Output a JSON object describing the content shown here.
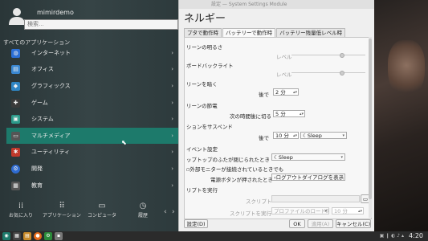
{
  "settings": {
    "title": "設定 — System Settings Module",
    "heading": "ネルギー",
    "tabs": [
      "プタで動作時",
      "バッテリーで動作時",
      "バッテリー残量低レベル時"
    ],
    "rows": {
      "screen_brightness": "リーンの明るさ",
      "level1": "レベル",
      "keyboard_backlight": "ボードバックライト",
      "level2": "レベル",
      "dim_screen": "リーンを暗く",
      "after1": "後で",
      "dim_value": "2 分",
      "screen_off": "リーンの節電",
      "switch_off_after": "次の時間後に切る",
      "screen_off_value": "5 分",
      "suspend": "ションをサスペンド",
      "after2": "後で",
      "suspend_value": "10 分",
      "suspend_mode": "Sleep",
      "event_settings": "イベント設定",
      "laptop_lid": "ップトップのふたが閉じられたとき",
      "lid_action": "Sleep",
      "external_monitor": "外部モニターが接続されているときでも",
      "power_button": "電源ボタンが押されたとき",
      "power_action": "ログアウトダイアログを表示",
      "run_script": "リプトを実行",
      "script_label": "スクリプト",
      "script_run_label": "スクリプトを実行",
      "script_when": "プロファイルのロード時",
      "script_minutes": "10 分"
    },
    "buttons": {
      "defaults": "設定(D)",
      "ok": "OK",
      "apply": "適用(A)",
      "cancel": "キャンセル(C)"
    }
  },
  "menu": {
    "username": "mimirdemo",
    "search_placeholder": "検索…",
    "all_apps": "すべてのアプリケーション",
    "categories": [
      {
        "label": "インターネット",
        "color": "#2b6fd6",
        "icon": "globe-icon"
      },
      {
        "label": "オフィス",
        "color": "#3a87d0",
        "icon": "office-icon"
      },
      {
        "label": "グラフィックス",
        "color": "#2f86c4",
        "icon": "graphics-icon"
      },
      {
        "label": "ゲーム",
        "color": "#3a3a3a",
        "icon": "gamepad-icon"
      },
      {
        "label": "システム",
        "color": "#2b9a8a",
        "icon": "system-icon"
      },
      {
        "label": "マルチメディア",
        "color": "#555",
        "icon": "multimedia-icon"
      },
      {
        "label": "ユーティリティ",
        "color": "#c0392b",
        "icon": "utilities-icon"
      },
      {
        "label": "開発",
        "color": "#2e6bd1",
        "icon": "development-icon"
      },
      {
        "label": "教育",
        "color": "#555",
        "icon": "education-icon"
      }
    ],
    "selected_index": 5,
    "nav": [
      "お気に入り",
      "アプリケーション",
      "コンピュータ",
      "履歴"
    ]
  },
  "taskbar": {
    "clock": "4:20"
  }
}
